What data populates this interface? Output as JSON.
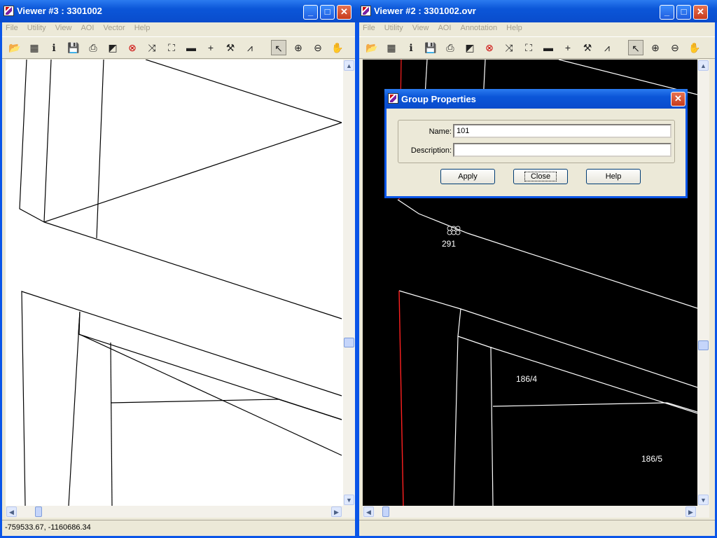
{
  "viewer3": {
    "title": "Viewer #3 : 3301002",
    "menu": [
      "File",
      "Utility",
      "View",
      "AOI",
      "Vector",
      "Help"
    ],
    "status": "-759533.67, -1160686.34"
  },
  "viewer2": {
    "title": "Viewer #2 : 3301002.ovr",
    "menu": [
      "File",
      "Utility",
      "View",
      "AOI",
      "Annotation",
      "Help"
    ],
    "labels": [
      "291",
      "186/4",
      "186/5"
    ]
  },
  "dialog": {
    "title": "Group Properties",
    "name_label": "Name:",
    "name_value": "101",
    "description_label": "Description:",
    "description_value": "",
    "apply": "Apply",
    "close": "Close",
    "help": "Help"
  },
  "icons": [
    "open-icon",
    "new-icon",
    "info-icon",
    "save-icon",
    "print-icon",
    "eraser-icon",
    "target-icon",
    "zoom-fit-icon",
    "zoom-full-icon",
    "measure-icon",
    "crosshair-icon",
    "hammer-icon",
    "profile-icon",
    "select-arrow-icon",
    "zoom-in-icon",
    "zoom-out-icon",
    "pan-hand-icon"
  ],
  "colors": {
    "titlebar": "#0a55e8",
    "canvas_dark": "#000000",
    "boundary": "#ff0000"
  }
}
